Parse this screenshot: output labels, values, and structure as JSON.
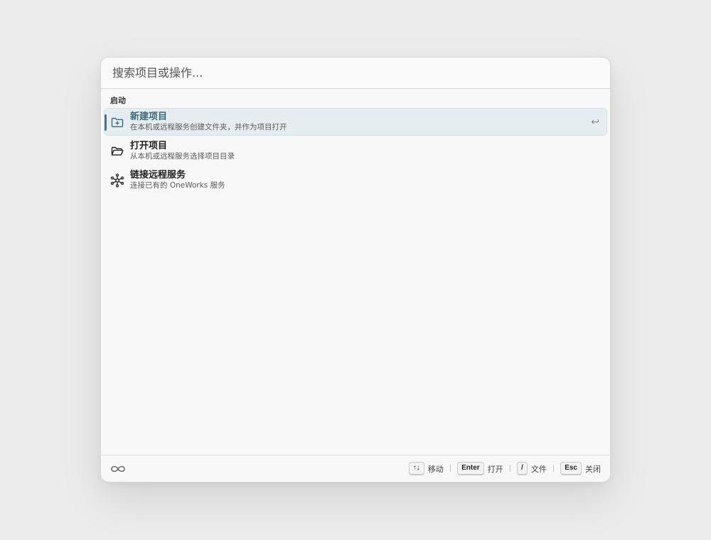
{
  "search": {
    "placeholder": "搜索项目或操作..."
  },
  "section": {
    "label": "启动"
  },
  "items": [
    {
      "title": "新建项目",
      "desc": "在本机或远程服务创建文件夹，并作为项目打开",
      "icon": "folder-plus-icon",
      "active": true
    },
    {
      "title": "打开项目",
      "desc": "从本机或远程服务选择项目目录",
      "icon": "folder-open-icon",
      "active": false
    },
    {
      "title": "链接远程服务",
      "desc": "连接已有的 OneWorks 服务",
      "icon": "network-icon",
      "active": false
    }
  ],
  "enter_hint": "↩",
  "footer": {
    "logo_icon": "infinity-logo-icon",
    "shortcuts": [
      {
        "key": "↑↓",
        "label": "移动"
      },
      {
        "key": "Enter",
        "label": "打开"
      },
      {
        "key": "/",
        "label": "文件"
      },
      {
        "key": "Esc",
        "label": "关闭"
      }
    ],
    "separator": "|"
  },
  "colors": {
    "accent": "#4f7383",
    "active_bg": "#e6edf0",
    "active_title": "#3f6a7c"
  }
}
